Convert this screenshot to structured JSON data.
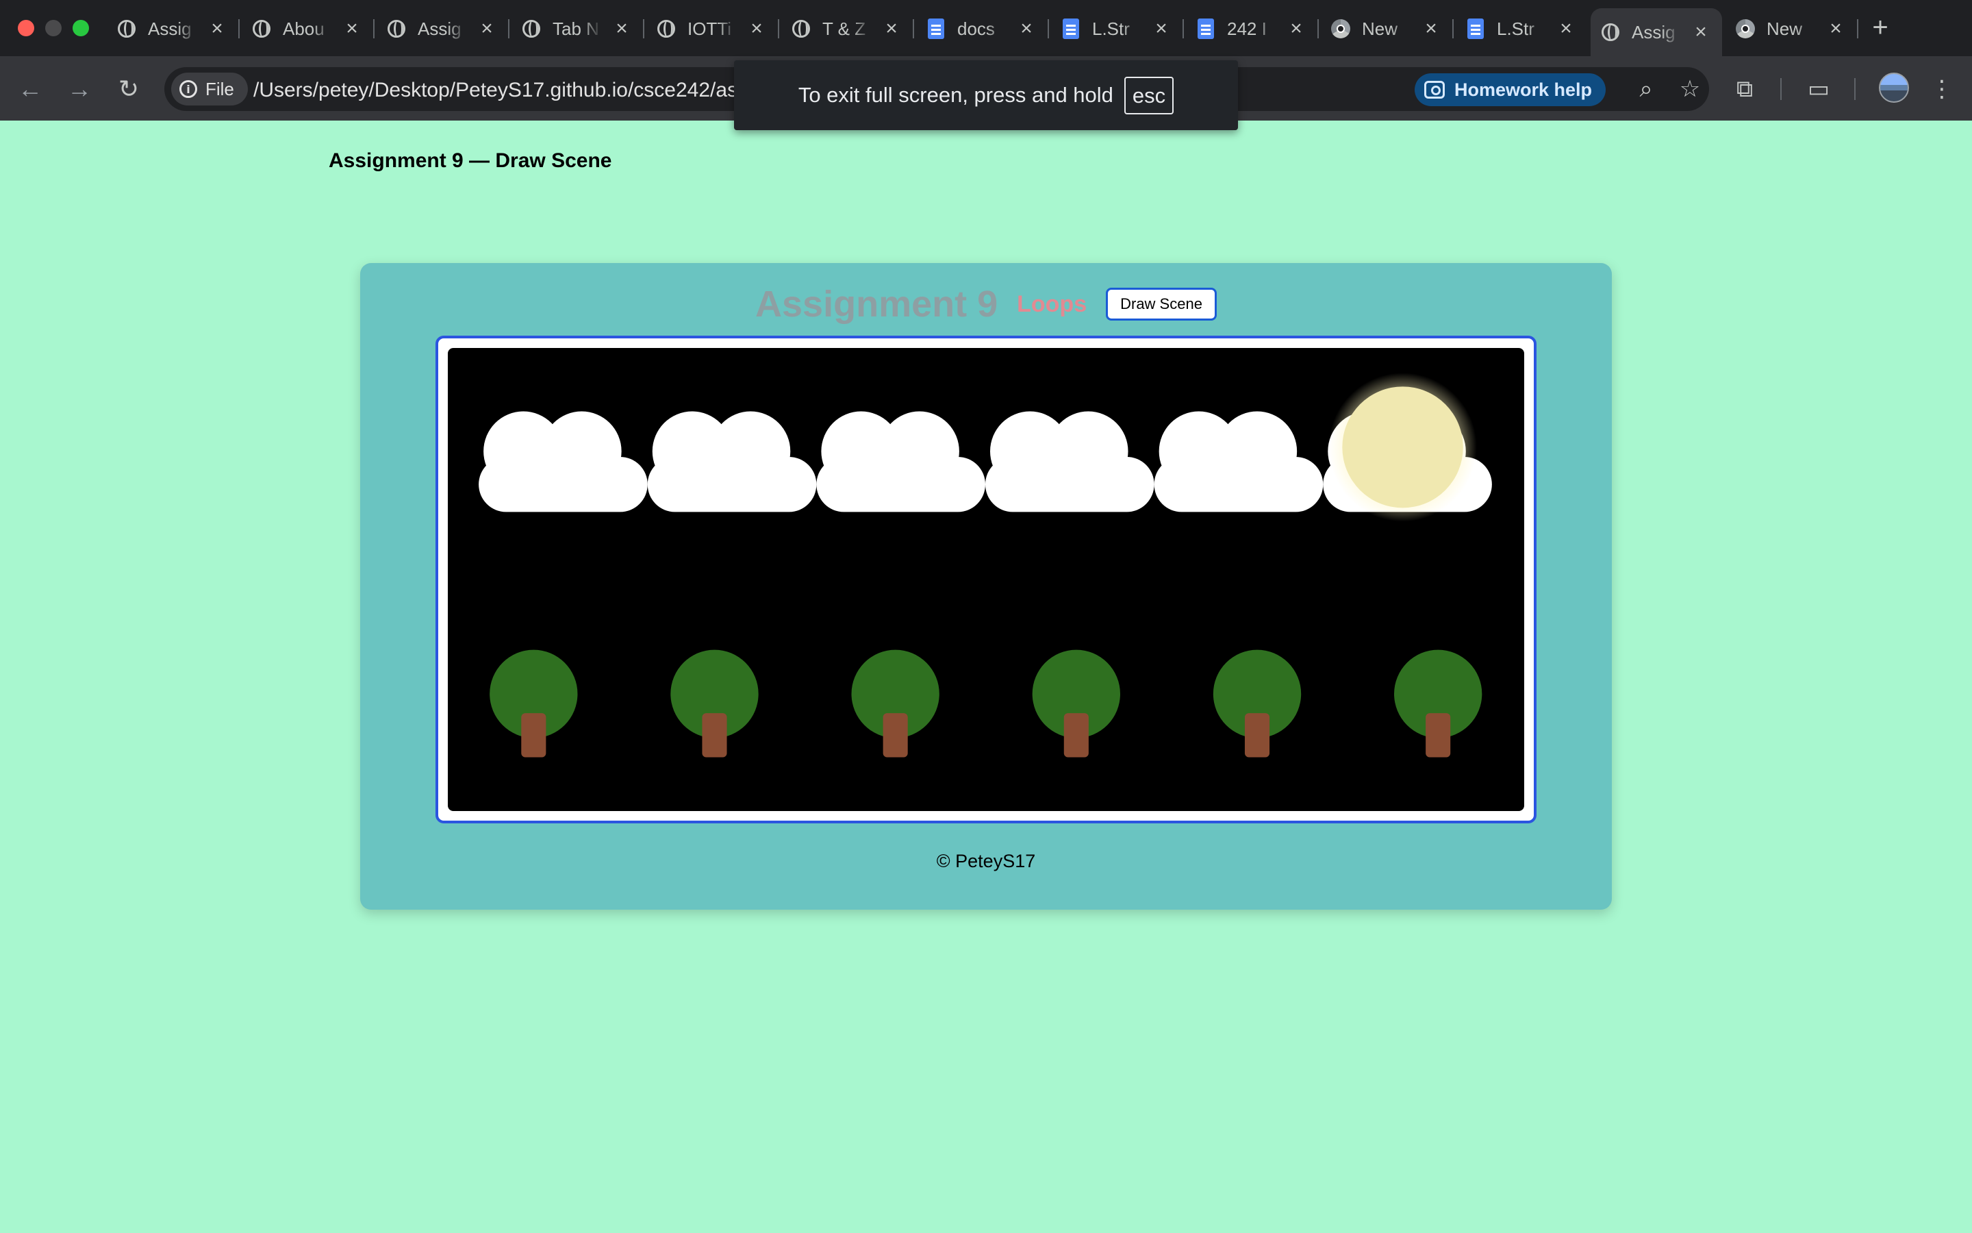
{
  "browser": {
    "tabs": [
      {
        "title": "Assig",
        "icon": "globe-icon"
      },
      {
        "title": "Abou",
        "icon": "globe-icon"
      },
      {
        "title": "Assig",
        "icon": "globe-icon"
      },
      {
        "title": "Tab N",
        "icon": "globe-icon"
      },
      {
        "title": "IOTTi",
        "icon": "globe-icon"
      },
      {
        "title": "T & Z",
        "icon": "globe-icon"
      },
      {
        "title": "docs",
        "icon": "docs-icon"
      },
      {
        "title": "L.Str",
        "icon": "docs-icon"
      },
      {
        "title": "242 I",
        "icon": "docs-icon"
      },
      {
        "title": "New",
        "icon": "chrome-icon"
      },
      {
        "title": "L.Str",
        "icon": "docs-icon"
      },
      {
        "title": "Assig",
        "icon": "globe-icon",
        "active": true
      },
      {
        "title": "New",
        "icon": "chrome-icon"
      }
    ],
    "address": {
      "scheme_chip": "File",
      "url": "/Users/petey/Desktop/PeteyS17.github.io/csce242/as"
    },
    "homework_help": "Homework help"
  },
  "fullscreen_toast": {
    "message": "To exit full screen, press and hold",
    "key": "esc"
  },
  "page": {
    "heading": "Assignment 9 — Draw Scene",
    "card": {
      "title": "Assignment 9",
      "subtitle": "Loops",
      "button_label": "Draw Scene",
      "footer": "© PeteyS17"
    },
    "scene": {
      "background": "#000000",
      "cloud_count": 6,
      "tree_count": 6,
      "colors": {
        "cloud": "#ffffff",
        "sun": "#f0e8b0",
        "foliage": "#2f7020",
        "trunk": "#8a4d33"
      }
    },
    "colors": {
      "page_background": "#a8f7cf",
      "card_background": "#6ac4c1",
      "frame_border": "#2b55e0"
    }
  }
}
